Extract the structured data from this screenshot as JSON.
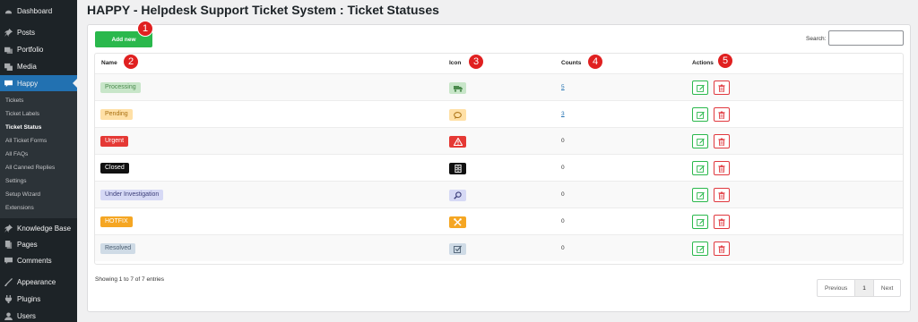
{
  "sidebar": {
    "items": [
      {
        "label": "Dashboard",
        "icon": "dashboard-icon"
      },
      {
        "label": "Posts",
        "icon": "pin-icon"
      },
      {
        "label": "Portfolio",
        "icon": "portfolio-icon"
      },
      {
        "label": "Media",
        "icon": "media-icon"
      },
      {
        "label": "Happy",
        "icon": "chat-icon",
        "active": true
      },
      {
        "label": "Knowledge Base",
        "icon": "pin-icon"
      },
      {
        "label": "Pages",
        "icon": "page-icon"
      },
      {
        "label": "Comments",
        "icon": "comment-icon"
      },
      {
        "label": "Appearance",
        "icon": "brush-icon"
      },
      {
        "label": "Plugins",
        "icon": "plug-icon"
      },
      {
        "label": "Users",
        "icon": "user-icon"
      }
    ],
    "submenu": [
      "Tickets",
      "Ticket Labels",
      "Ticket Status",
      "All Ticket Forms",
      "All FAQs",
      "All Canned Replies",
      "Settings",
      "Setup Wizard",
      "Extensions"
    ],
    "current_submenu": "Ticket Status"
  },
  "page": {
    "title": "HAPPY - Helpdesk Support Ticket System : Ticket Statuses"
  },
  "toolbar": {
    "add_label": "Add new",
    "search_label": "Search:",
    "search_value": ""
  },
  "table": {
    "headers": {
      "name": "Name",
      "icon": "Icon",
      "counts": "Counts",
      "actions": "Actions"
    },
    "rows": [
      {
        "name": "Processing",
        "bg": "#c8e6c9",
        "fg": "#4a8a4c",
        "icon": "truck-icon",
        "icon_bg": "#c8e6c9",
        "icon_fg": "#4a8a4c",
        "count": "5",
        "link": true
      },
      {
        "name": "Pending",
        "bg": "#ffe0a6",
        "fg": "#a86f10",
        "icon": "speech-bubble-icon",
        "icon_bg": "#ffe0a6",
        "icon_fg": "#a86f10",
        "count": "3",
        "link": true
      },
      {
        "name": "Urgent",
        "bg": "#e53935",
        "fg": "#ffffff",
        "icon": "warning-icon",
        "icon_bg": "#e53935",
        "icon_fg": "#ffffff",
        "count": "0",
        "link": false
      },
      {
        "name": "Closed",
        "bg": "#111111",
        "fg": "#ffffff",
        "icon": "archive-icon",
        "icon_bg": "#111111",
        "icon_fg": "#ffffff",
        "count": "0",
        "link": false
      },
      {
        "name": "Under Investigation",
        "bg": "#d6d9f5",
        "fg": "#3d3f7a",
        "icon": "magnifier-icon",
        "icon_bg": "#d6d9f5",
        "icon_fg": "#3d3f7a",
        "count": "0",
        "link": false
      },
      {
        "name": "HOTFIX",
        "bg": "#f5a623",
        "fg": "#ffffff",
        "icon": "tools-icon",
        "icon_bg": "#f5a623",
        "icon_fg": "#ffffff",
        "count": "0",
        "link": false
      },
      {
        "name": "Resolved",
        "bg": "#cfdbe6",
        "fg": "#4a5d70",
        "icon": "checkbox-icon",
        "icon_bg": "#cfdbe6",
        "icon_fg": "#4a5d70",
        "count": "0",
        "link": false
      }
    ]
  },
  "footer": {
    "showing": "Showing 1 to 7 of 7 entries",
    "prev": "Previous",
    "page": "1",
    "next": "Next"
  },
  "markers": [
    "1",
    "2",
    "3",
    "4",
    "5"
  ],
  "colors": {
    "accent": "#2271b1",
    "add_button": "#2ab84c",
    "delete": "#e0383e",
    "marker": "#e02020"
  }
}
